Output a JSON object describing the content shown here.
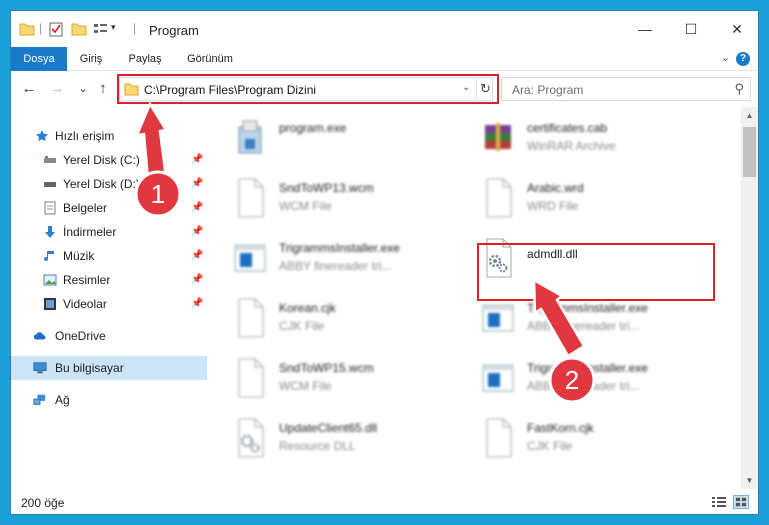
{
  "window": {
    "title": "Program",
    "controls": {
      "minimize": "—",
      "maximize": "☐",
      "close": "✕"
    }
  },
  "ribbon": {
    "tabs": [
      "Dosya",
      "Giriş",
      "Paylaş",
      "Görünüm"
    ],
    "help": "?"
  },
  "navigation": {
    "back": "←",
    "forward": "→",
    "recent": "⌄",
    "up": "↑",
    "address": "C:\\Program Files\\Program Dizini",
    "refresh": "↻",
    "search_placeholder": "Ara: Program"
  },
  "sidebar": {
    "items": [
      {
        "label": "Hızlı erişim",
        "icon": "star-icon"
      },
      {
        "label": "Yerel Disk (C:)",
        "icon": "drive-icon",
        "pinned": true
      },
      {
        "label": "Yerel Disk (D:)",
        "icon": "drive-icon",
        "pinned": true
      },
      {
        "label": "Belgeler",
        "icon": "documents-icon",
        "pinned": true
      },
      {
        "label": "İndirmeler",
        "icon": "download-icon",
        "pinned": true
      },
      {
        "label": "Müzik",
        "icon": "music-icon",
        "pinned": true
      },
      {
        "label": "Resimler",
        "icon": "pictures-icon",
        "pinned": true
      },
      {
        "label": "Videolar",
        "icon": "videos-icon",
        "pinned": true
      },
      {
        "label": "OneDrive",
        "icon": "cloud-icon"
      },
      {
        "label": "Bu bilgisayar",
        "icon": "computer-icon",
        "selected": true
      },
      {
        "label": "Ağ",
        "icon": "network-icon"
      }
    ]
  },
  "files": [
    {
      "name": "program.exe",
      "type": "",
      "icon": "installer-icon"
    },
    {
      "name": "certificates.cab",
      "type": "WinRAR Archive",
      "icon": "archive-icon"
    },
    {
      "name": "SndToWP13.wcm",
      "type": "WCM File",
      "icon": "blank-file-icon"
    },
    {
      "name": "Arabic.wrd",
      "type": "WRD File",
      "icon": "blank-file-icon"
    },
    {
      "name": "TrigrammsInstaller.exe",
      "type": "ABBY finereader tri...",
      "icon": "app-window-icon"
    },
    {
      "name": "admdll.dll",
      "type": "",
      "icon": "dll-gear-icon"
    },
    {
      "name": "Korean.cjk",
      "type": "CJK File",
      "icon": "blank-file-icon"
    },
    {
      "name": "TrigrammsInstaller.exe",
      "type": "ABBY finereader tri...",
      "icon": "app-window-icon"
    },
    {
      "name": "SndToWP15.wcm",
      "type": "WCM File",
      "icon": "blank-file-icon"
    },
    {
      "name": "TrigrammsInstaller.exe",
      "type": "ABBY finereader tri...",
      "icon": "app-window-icon"
    },
    {
      "name": "UpdateClient65.dll",
      "type": "Resource DLL",
      "icon": "dll-gear-icon"
    },
    {
      "name": "FastKorn.cjk",
      "type": "CJK File",
      "icon": "blank-file-icon"
    }
  ],
  "status": {
    "item_count": "200 öğe"
  },
  "annotations": {
    "step1": "1",
    "step2": "2"
  },
  "colors": {
    "accent": "#1979ca",
    "highlight": "#d6212b",
    "badge": "#e0383e",
    "selected": "#cce4f7"
  }
}
